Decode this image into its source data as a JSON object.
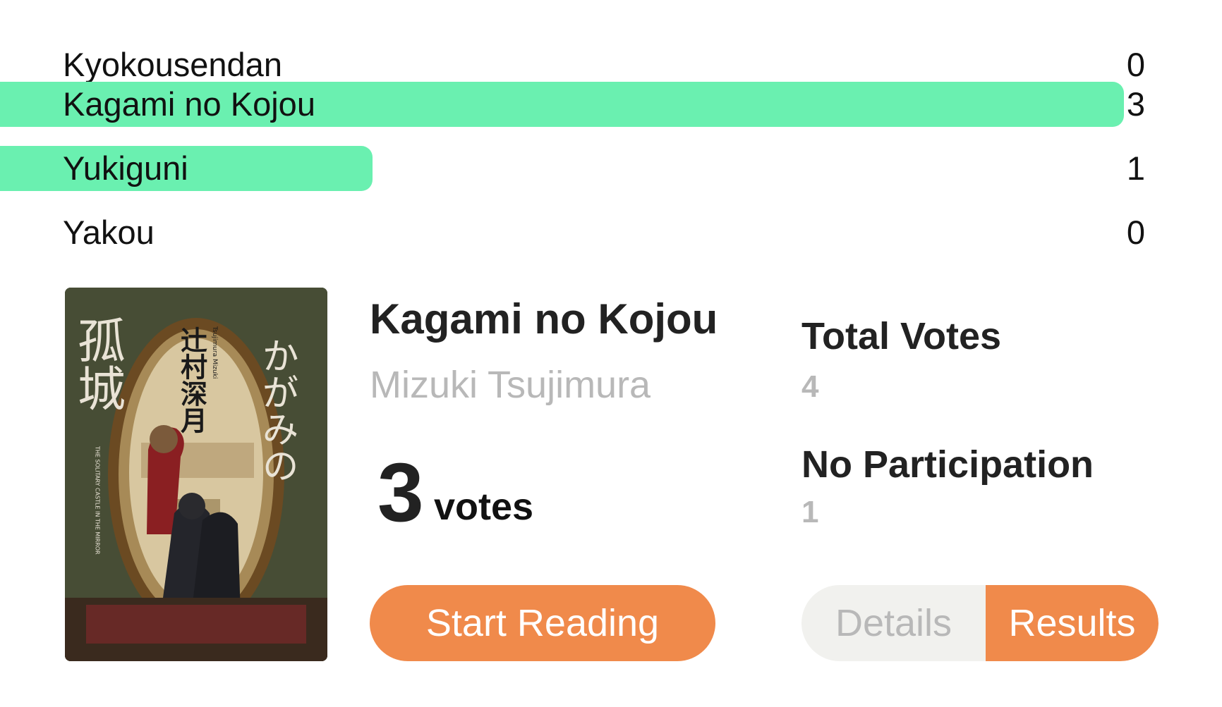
{
  "poll": {
    "options": [
      {
        "label": "Kyokousendan",
        "count": "0",
        "bar_fraction": 0
      },
      {
        "label": "Kagami no Kojou",
        "count": "3",
        "bar_fraction": 0.92
      },
      {
        "label": "Yukiguni",
        "count": "1",
        "bar_fraction": 0.305
      },
      {
        "label": "Yakou",
        "count": "0",
        "bar_fraction": 0
      }
    ],
    "bar_color": "#6af0b0"
  },
  "book": {
    "title": "Kagami no Kojou",
    "author": "Mizuki Tsujimura",
    "votes_number": "3",
    "votes_unit": "votes",
    "cover": {
      "title_kana": "かがみの",
      "title_kanji": "孤城",
      "author_kanji": "辻村深月",
      "author_romaji": "Tsujimura Mizuki",
      "subtitle_en": "THE SOLITARY CASTLE IN THE MIRROR"
    }
  },
  "stats": {
    "total_votes_label": "Total Votes",
    "total_votes_value": "4",
    "no_participation_label": "No Participation",
    "no_participation_value": "1"
  },
  "actions": {
    "start_reading_label": "Start Reading",
    "details_label": "Details",
    "results_label": "Results",
    "active_tab": "Results"
  },
  "colors": {
    "accent": "#f08a4b",
    "muted_text": "#b8b8b8",
    "toggle_bg": "#f1f1ee"
  }
}
